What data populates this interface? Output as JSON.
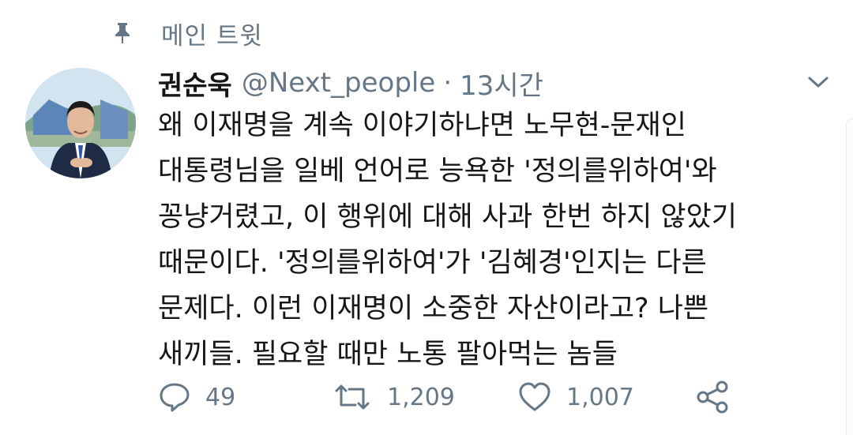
{
  "pinned": {
    "label": "메인 트윗",
    "icon": "pin-icon"
  },
  "author": {
    "display_name": "권순욱",
    "handle": "@Next_people",
    "separator": "·",
    "timestamp": "13시간",
    "avatar_icon": "avatar"
  },
  "tweet": {
    "lines": [
      "왜 이재명을 계속 이야기하냐면 노무현-문재인",
      "대통령님을 일베 언어로 능욕한 '정의를위하여'와",
      "꽁냥거렸고, 이 행위에 대해 사과 한번 하지 않았기",
      "때문이다. '정의를위하여'가 '김혜경'인지는 다른",
      "문제다. 이런 이재명이 소중한 자산이라고? 나쁜",
      "새끼들. 필요할 때만 노통 팔아먹는 놈들"
    ]
  },
  "actions": {
    "reply_count": "49",
    "retweet_count": "1,209",
    "like_count": "1,007"
  },
  "colors": {
    "text_primary": "#14171a",
    "text_secondary": "#657786",
    "background": "#ffffff"
  }
}
